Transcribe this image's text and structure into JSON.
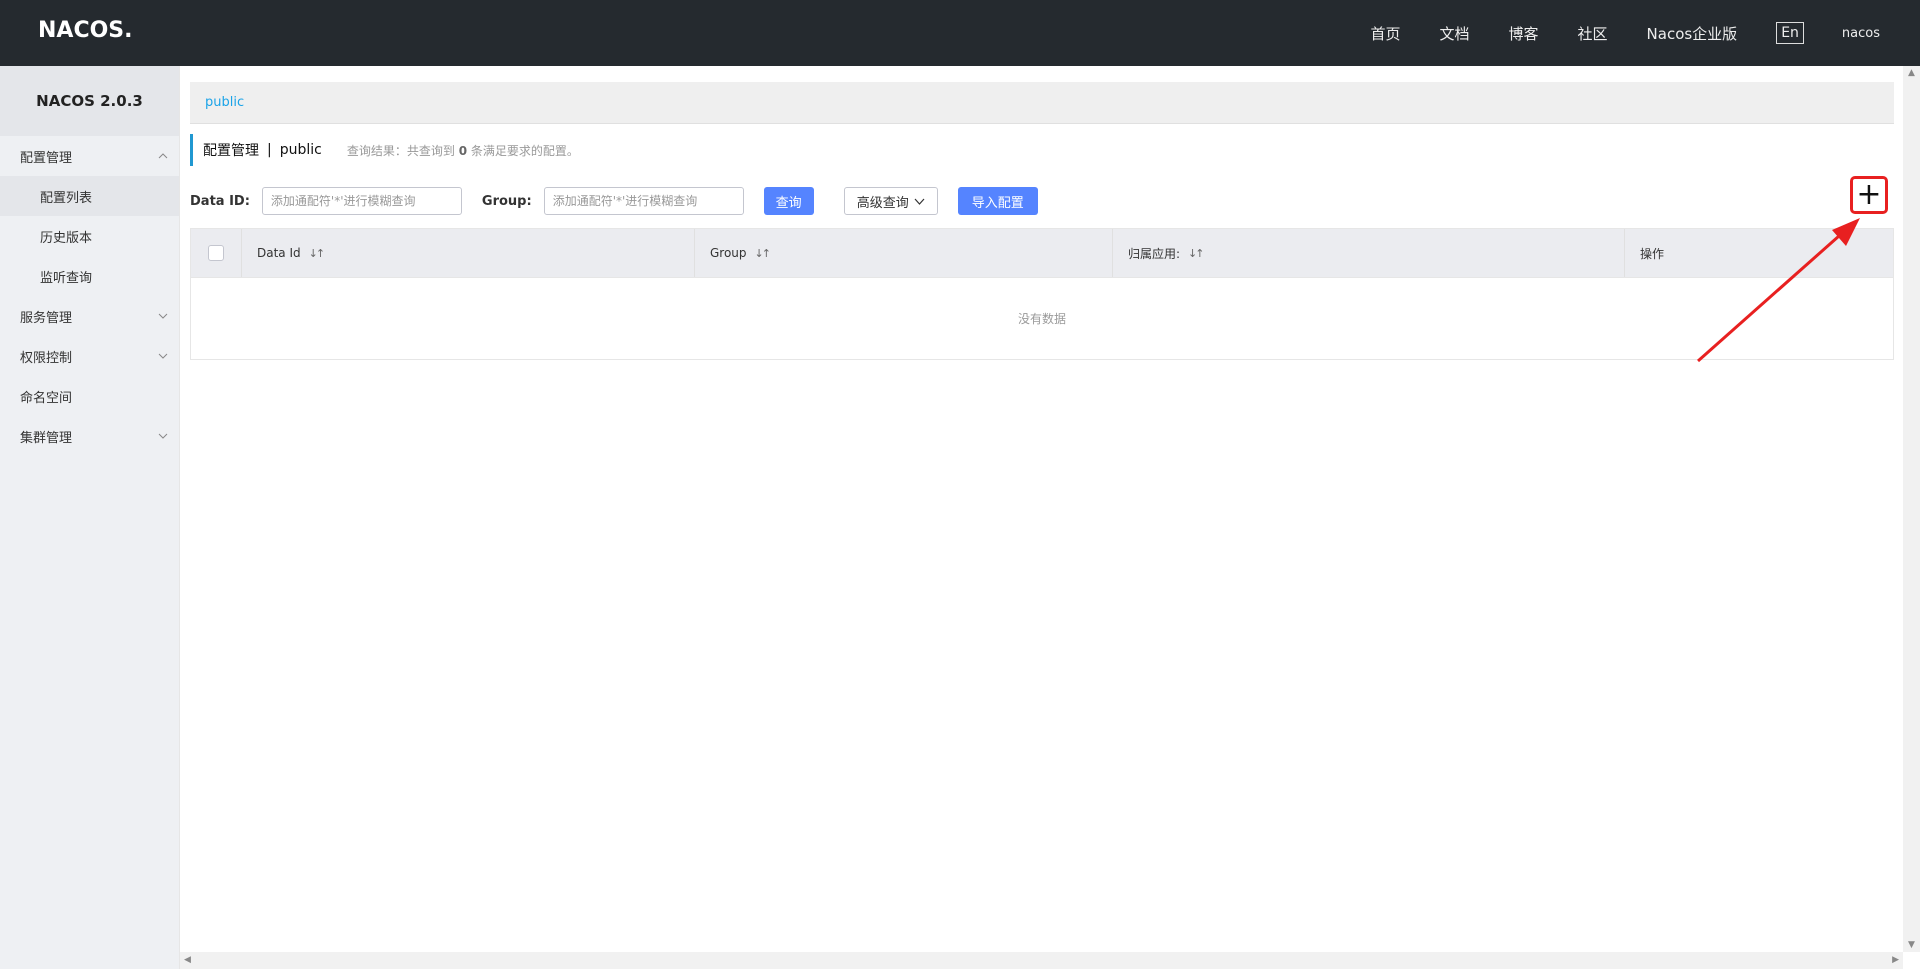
{
  "header": {
    "logo": "NACOS.",
    "nav": [
      "首页",
      "文档",
      "博客",
      "社区",
      "Nacos企业版"
    ],
    "lang": "En",
    "user": "nacos"
  },
  "sidebar": {
    "version": "NACOS 2.0.3",
    "groups": [
      {
        "label": "配置管理",
        "expanded": true,
        "items": [
          "配置列表",
          "历史版本",
          "监听查询"
        ]
      },
      {
        "label": "服务管理",
        "expanded": false
      },
      {
        "label": "权限控制",
        "expanded": false
      },
      {
        "label": "命名空间"
      },
      {
        "label": "集群管理",
        "expanded": false
      }
    ],
    "active_item": "配置列表"
  },
  "namespace_bar": {
    "current": "public"
  },
  "title": {
    "main": "配置管理",
    "sep": "|",
    "namespace": "public",
    "result_prefix": "查询结果：共查询到",
    "result_count": "0",
    "result_suffix": "条满足要求的配置。"
  },
  "search": {
    "data_id_label": "Data ID:",
    "data_id_placeholder": "添加通配符'*'进行模糊查询",
    "group_label": "Group:",
    "group_placeholder": "添加通配符'*'进行模糊查询",
    "query_button": "查询",
    "advanced_button": "高级查询",
    "import_button": "导入配置",
    "add_button": "+"
  },
  "table": {
    "columns": [
      "Data Id",
      "Group",
      "归属应用:",
      "操作"
    ],
    "empty_text": "没有数据"
  },
  "colors": {
    "header_bg": "#252a2f",
    "primary": "#5584ff",
    "link": "#1aa3e8",
    "highlight": "#e82020"
  }
}
